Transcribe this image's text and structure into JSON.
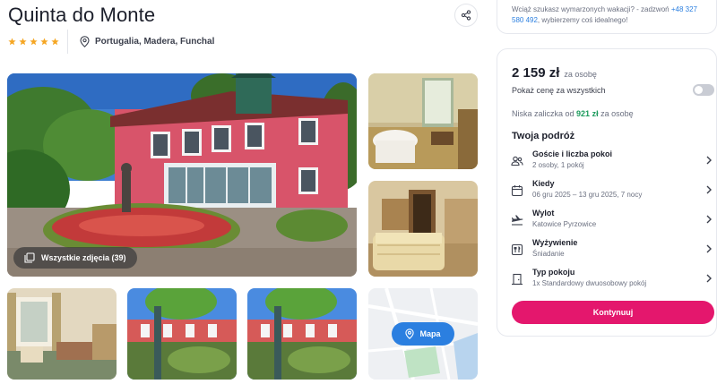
{
  "hotel": {
    "name": "Quinta do Monte",
    "stars": 5,
    "location": "Portugalia, Madera, Funchal"
  },
  "gallery": {
    "all_photos_label": "Wszystkie zdjęcia (39)",
    "map_label": "Mapa"
  },
  "info_banner": {
    "text_before": "Wciąż szukasz wymarzonych wakacji? - zadzwoń",
    "phone": "+48 327 580 492",
    "text_after": ", wybierzemy coś idealnego!"
  },
  "booking": {
    "price": "2 159 zł",
    "per_person": "za osobę",
    "toggle_label": "Pokaż cenę za wszystkich",
    "deposit_prefix": "Niska zaliczka od",
    "deposit_amount": "921 zł",
    "deposit_suffix": "za osobę",
    "trip_title": "Twoja podróż",
    "rows": [
      {
        "icon": "guests-icon",
        "label": "Goście i liczba pokoi",
        "value": "2 osoby, 1 pokój"
      },
      {
        "icon": "calendar-icon",
        "label": "Kiedy",
        "value": "06 gru 2025 – 13 gru 2025, 7 nocy"
      },
      {
        "icon": "plane-icon",
        "label": "Wylot",
        "value": "Katowice Pyrzowice"
      },
      {
        "icon": "meal-icon",
        "label": "Wyżywienie",
        "value": "Śniadanie"
      },
      {
        "icon": "room-icon",
        "label": "Typ pokoju",
        "value": "1x Standardowy dwuosobowy pokój"
      }
    ],
    "cta_label": "Kontynuuj"
  },
  "colors": {
    "accent": "#e4176d",
    "link": "#2b7fe0",
    "deposit": "#1a9a5b",
    "star": "#f5a623"
  }
}
